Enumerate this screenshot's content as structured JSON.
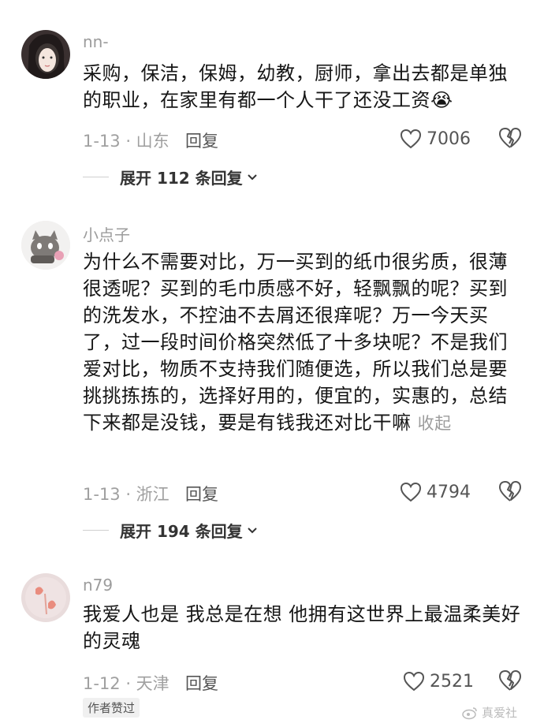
{
  "comments": [
    {
      "username": "nn-",
      "text": "采购，保洁，保姆，幼教，厨师，拿出去都是单独的职业，在家里有都一个人干了还没工资",
      "emoji": "😭",
      "date_location": "1-13 · 山东",
      "reply_label": "回复",
      "likes": "7006",
      "expand_label": "展开 112 条回复"
    },
    {
      "username": "小点子",
      "text": "为什么不需要对比，万一买到的纸巾很劣质，很薄很透呢？买到的毛巾质感不好，轻飘飘的呢？买到的洗发水，不控油不去屑还很痒呢？万一今天买了，过一段时间价格突然低了十多块呢？不是我们爱对比，物质不支持我们随便选，所以我们总是要挑挑拣拣的，选择好用的，便宜的，实惠的，总结下来都是没钱，要是有钱我还对比干嘛",
      "collapse_label": "收起",
      "date_location": "1-13 · 浙江",
      "reply_label": "回复",
      "likes": "4794",
      "expand_label": "展开 194 条回复"
    },
    {
      "username": "n79",
      "text": "我爱人也是 我总是在想 他拥有这世界上最温柔美好的灵魂",
      "date_location": "1-12 · 天津",
      "reply_label": "回复",
      "likes": "2521",
      "badge": "作者赞过"
    }
  ],
  "watermark": "真爱社",
  "colors": {
    "meta": "#a0a0a0",
    "text": "#161616",
    "badge_bg": "#f0f0f0"
  }
}
